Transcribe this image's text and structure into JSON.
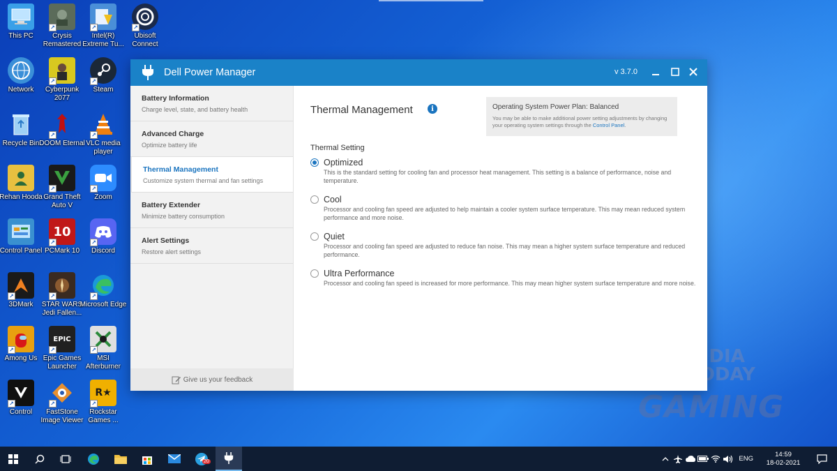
{
  "desktop": {
    "icons": [
      {
        "label": "This PC",
        "color": "#3aa0e8"
      },
      {
        "label": "Crysis Remastered",
        "color": "#5b6b5a"
      },
      {
        "label": "Intel(R) Extreme Tu...",
        "color": "#4a8fd8"
      },
      {
        "label": "Ubisoft Connect",
        "color": "#1b2a4a"
      },
      {
        "label": "Network",
        "color": "#3a8fd8"
      },
      {
        "label": "Cyberpunk 2077",
        "color": "#d8c820"
      },
      {
        "label": "Steam",
        "color": "#1b2838"
      },
      {
        "label": "Recycle Bin",
        "color": "#7ab8e8"
      },
      {
        "label": "DOOM Eternal",
        "color": "#b01010"
      },
      {
        "label": "VLC media player",
        "color": "#f08010"
      },
      {
        "label": "Rehan Hooda",
        "color": "#e8c040"
      },
      {
        "label": "Grand Theft Auto V",
        "color": "#2a7a2a"
      },
      {
        "label": "Zoom",
        "color": "#2d8cff"
      },
      {
        "label": "Control Panel",
        "color": "#3a90d0"
      },
      {
        "label": "PCMark 10",
        "color": "#c01818"
      },
      {
        "label": "Discord",
        "color": "#5865f2"
      },
      {
        "label": "3DMark",
        "color": "#1a1a1a"
      },
      {
        "label": "STAR WARS Jedi Fallen...",
        "color": "#3a2a20"
      },
      {
        "label": "Microsoft Edge",
        "color": "#1a9ad8"
      },
      {
        "label": "Among Us",
        "color": "#d81818"
      },
      {
        "label": "Epic Games Launcher",
        "color": "#202020"
      },
      {
        "label": "MSI Afterburner",
        "color": "#e0e0e0"
      },
      {
        "label": "Control",
        "color": "#101010"
      },
      {
        "label": "FastStone Image Viewer",
        "color": "#d87a20"
      },
      {
        "label": "Rockstar Games ...",
        "color": "#f0b000"
      }
    ],
    "glyphs": {
      "10": "10",
      "epic": "EPIC",
      "r": "R★"
    }
  },
  "window": {
    "title": "Dell Power Manager",
    "version": "v 3.7.0",
    "accent": "#1a82c8"
  },
  "sidebar": {
    "items": [
      {
        "title": "Battery Information",
        "subtitle": "Charge level, state, and battery health"
      },
      {
        "title": "Advanced Charge",
        "subtitle": "Optimize battery life"
      },
      {
        "title": "Thermal Management",
        "subtitle": "Customize system thermal and fan settings"
      },
      {
        "title": "Battery Extender",
        "subtitle": "Minimize battery consumption"
      },
      {
        "title": "Alert Settings",
        "subtitle": "Restore alert settings"
      }
    ],
    "active_index": 2,
    "feedback_label": "Give us your feedback"
  },
  "main": {
    "title": "Thermal Management",
    "info_glyph": "i",
    "power_plan": {
      "title": "Operating System Power Plan: Balanced",
      "description": "You may be able to make additional power setting adjustments by changing your operating system settings through the",
      "link": "Control Panel",
      "suffix": "."
    },
    "setting_label": "Thermal Setting",
    "options": [
      {
        "name": "Optimized",
        "checked": true,
        "description": "This is the standard setting for cooling fan and processor heat management. This setting is a balance of performance, noise and temperature."
      },
      {
        "name": "Cool",
        "checked": false,
        "description": "Processor and cooling fan speed are adjusted to help maintain a cooler system surface temperature. This may mean reduced system performance and more noise."
      },
      {
        "name": "Quiet",
        "checked": false,
        "description": "Processor and cooling fan speed are adjusted to reduce fan noise. This may mean a higher system surface temperature and reduced performance."
      },
      {
        "name": "Ultra Performance",
        "checked": false,
        "description": "Processor and cooling fan speed is increased for more performance. This may mean higher system surface temperature and more noise."
      }
    ]
  },
  "watermark": {
    "line1": "INDIA",
    "line2": "TODAY",
    "line3": "GAMING"
  },
  "taskbar": {
    "language": "ENG",
    "time": "14:59",
    "date": "18-02-2021",
    "telegram_badge": "20"
  }
}
